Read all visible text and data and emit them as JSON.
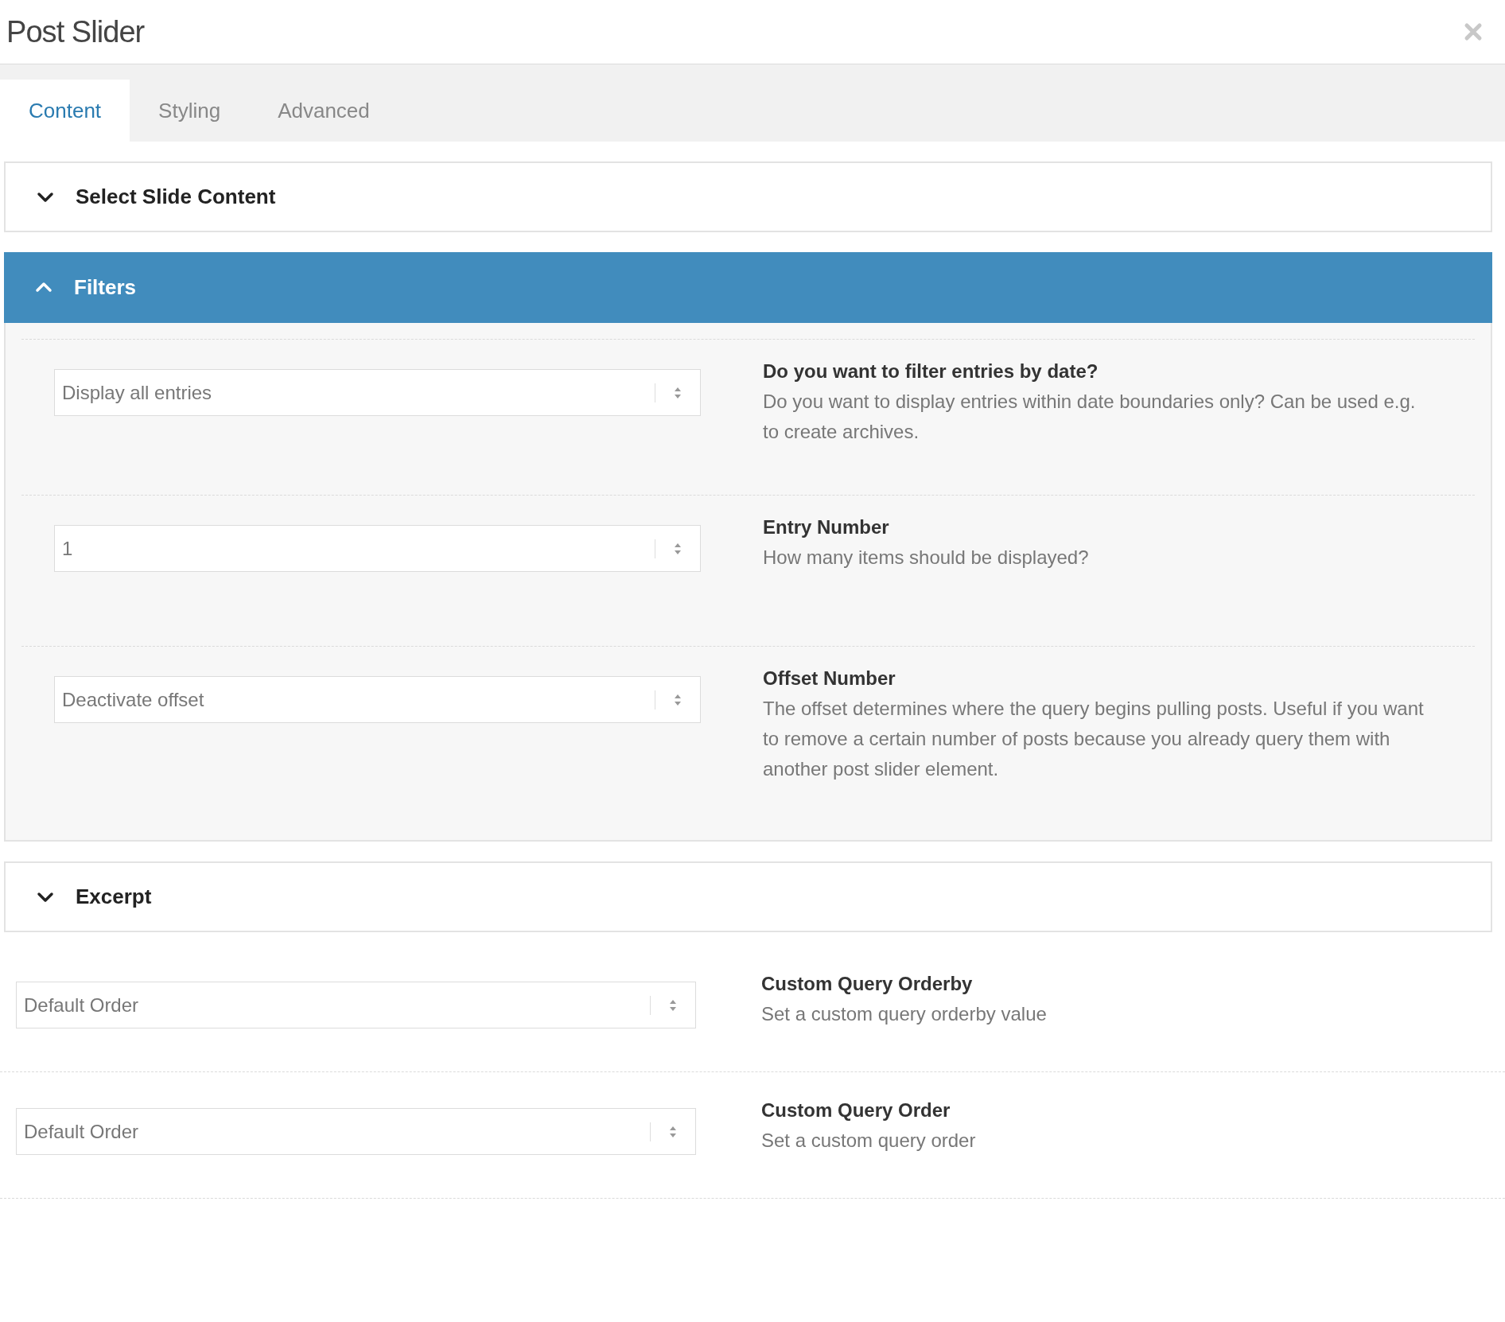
{
  "window": {
    "title": "Post Slider"
  },
  "tabs": [
    {
      "label": "Content",
      "selected": true
    },
    {
      "label": "Styling",
      "selected": false
    },
    {
      "label": "Advanced",
      "selected": false
    }
  ],
  "panels": [
    {
      "title": "Select Slide Content",
      "expanded": false
    },
    {
      "title": "Filters",
      "expanded": true,
      "fields": [
        {
          "value": "Display all entries",
          "label": "Do you want to filter entries by date?",
          "description": "Do you want to display entries within date boundaries only? Can be used e.g. to create archives."
        },
        {
          "value": "1",
          "label": "Entry Number",
          "description": "How many items should be displayed?"
        },
        {
          "value": "Deactivate offset",
          "label": "Offset Number",
          "description": "The offset determines where the query begins pulling posts. Useful if you want to remove a certain number of posts because you already query them with another post slider element."
        }
      ]
    },
    {
      "title": "Excerpt",
      "expanded": false
    }
  ],
  "fields": [
    {
      "value": "Default Order",
      "label": "Custom Query Orderby",
      "description": "Set a custom query orderby value"
    },
    {
      "value": "Default Order",
      "label": "Custom Query Order",
      "description": "Set a custom query order"
    }
  ]
}
